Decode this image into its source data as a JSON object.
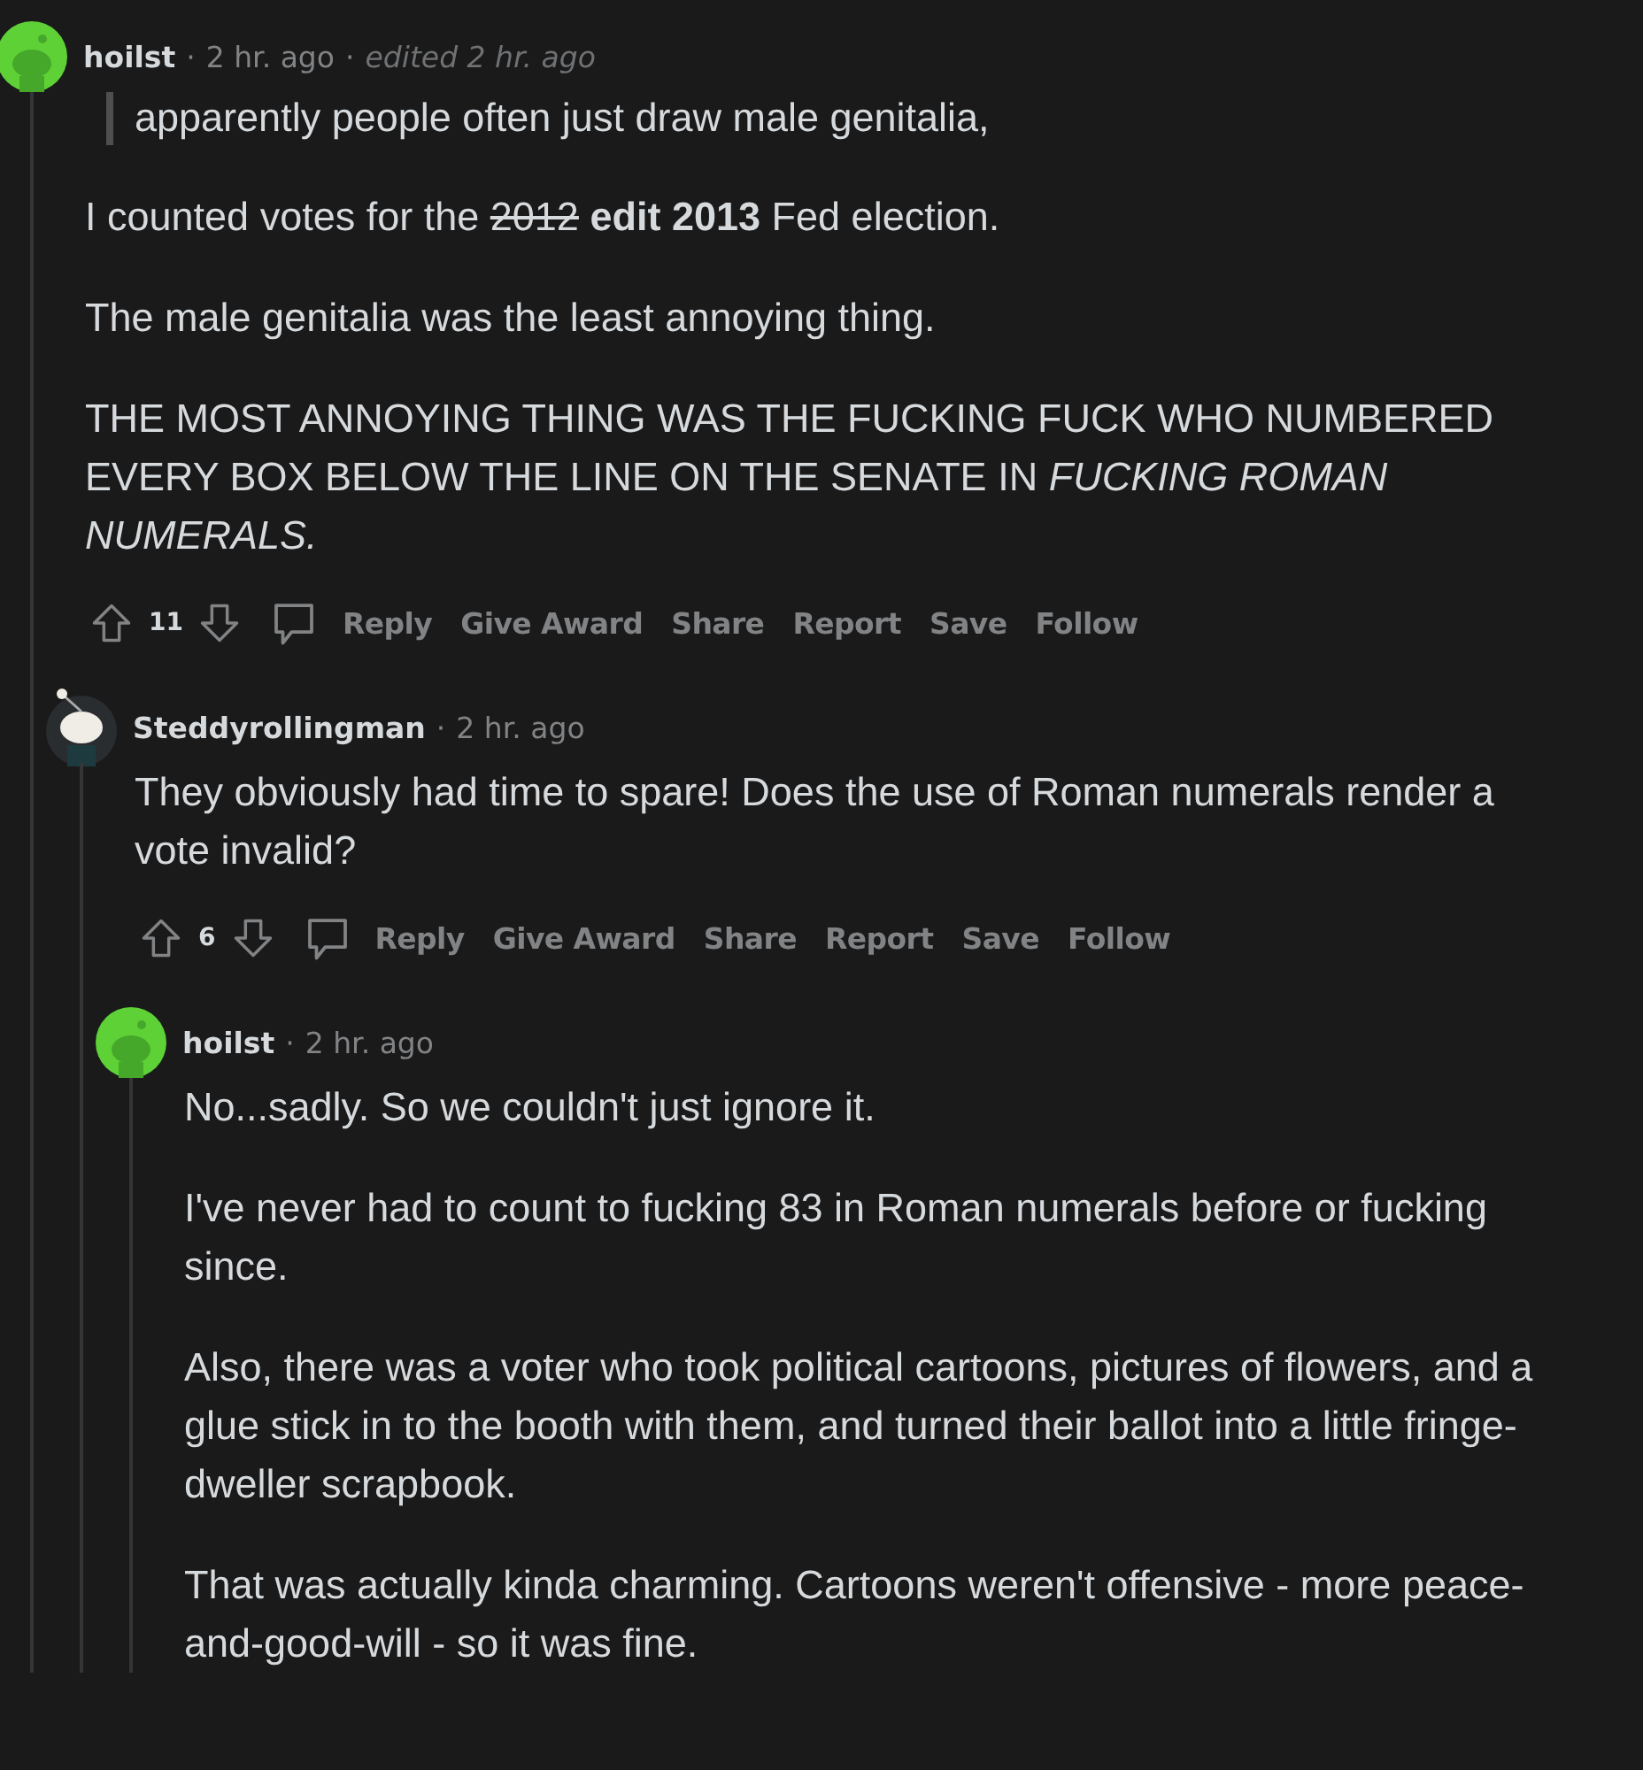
{
  "comments": [
    {
      "author": "hoilst",
      "avatar": {
        "kind": "plain"
      },
      "separator": "·",
      "time": "2 hr. ago",
      "edited": "edited 2 hr. ago",
      "paragraphs": [
        {
          "kind": "quote",
          "parts": [
            {
              "kind": "plain",
              "text": "apparently people often just draw male genitalia,"
            }
          ]
        },
        {
          "kind": "text",
          "parts": [
            {
              "kind": "plain",
              "text": "I counted votes for the "
            },
            {
              "kind": "strike",
              "text": "2012"
            },
            {
              "kind": "plain",
              "text": " **edit 2013** Fed election."
            }
          ]
        },
        {
          "kind": "text",
          "parts": [
            {
              "kind": "plain",
              "text": "The male genitalia was the least annoying thing."
            }
          ]
        },
        {
          "kind": "text",
          "parts": [
            {
              "kind": "plain",
              "text": "THE MOST ANNOYING THING WAS THE FUCKING FUCK WHO NUMBERED EVERY BOX BELOW THE LINE ON THE SENATE IN *FUCKING ROMAN NUMERALS.*"
            }
          ]
        }
      ],
      "votes": "11",
      "actions": [
        "Reply",
        "Give Award",
        "Share",
        "Report",
        "Save",
        "Follow"
      ],
      "children": [
        {
          "author": "Steddyrollingman",
          "avatar": {
            "kind": "mascot"
          },
          "separator": "·",
          "time": "2 hr. ago",
          "paragraphs": [
            {
              "kind": "text",
              "parts": [
                {
                  "kind": "plain",
                  "text": "They obviously had time to spare! Does the use of Roman numerals render a vote invalid?"
                }
              ]
            }
          ],
          "votes": "6",
          "actions": [
            "Reply",
            "Give Award",
            "Share",
            "Report",
            "Save",
            "Follow"
          ],
          "children": [
            {
              "author": "hoilst",
              "avatar": {
                "kind": "plain"
              },
              "separator": "·",
              "time": "2 hr. ago",
              "paragraphs": [
                {
                  "kind": "text",
                  "parts": [
                    {
                      "kind": "plain",
                      "text": "No...sadly. So we couldn't just ignore it."
                    }
                  ]
                },
                {
                  "kind": "text",
                  "parts": [
                    {
                      "kind": "plain",
                      "text": "I've never had to count to fucking 83 in Roman numerals before or fucking since."
                    }
                  ]
                },
                {
                  "kind": "text",
                  "parts": [
                    {
                      "kind": "plain",
                      "text": "Also, there was a voter who took political cartoons, pictures of flowers, and a glue stick in to the booth with them, and turned their ballot into a little fringe-dweller scrapbook."
                    }
                  ]
                },
                {
                  "kind": "text",
                  "parts": [
                    {
                      "kind": "plain",
                      "text": "That was actually kinda charming. Cartoons weren't offensive - more peace-and-good-will - so it was fine."
                    }
                  ]
                }
              ]
            }
          ]
        }
      ]
    }
  ]
}
